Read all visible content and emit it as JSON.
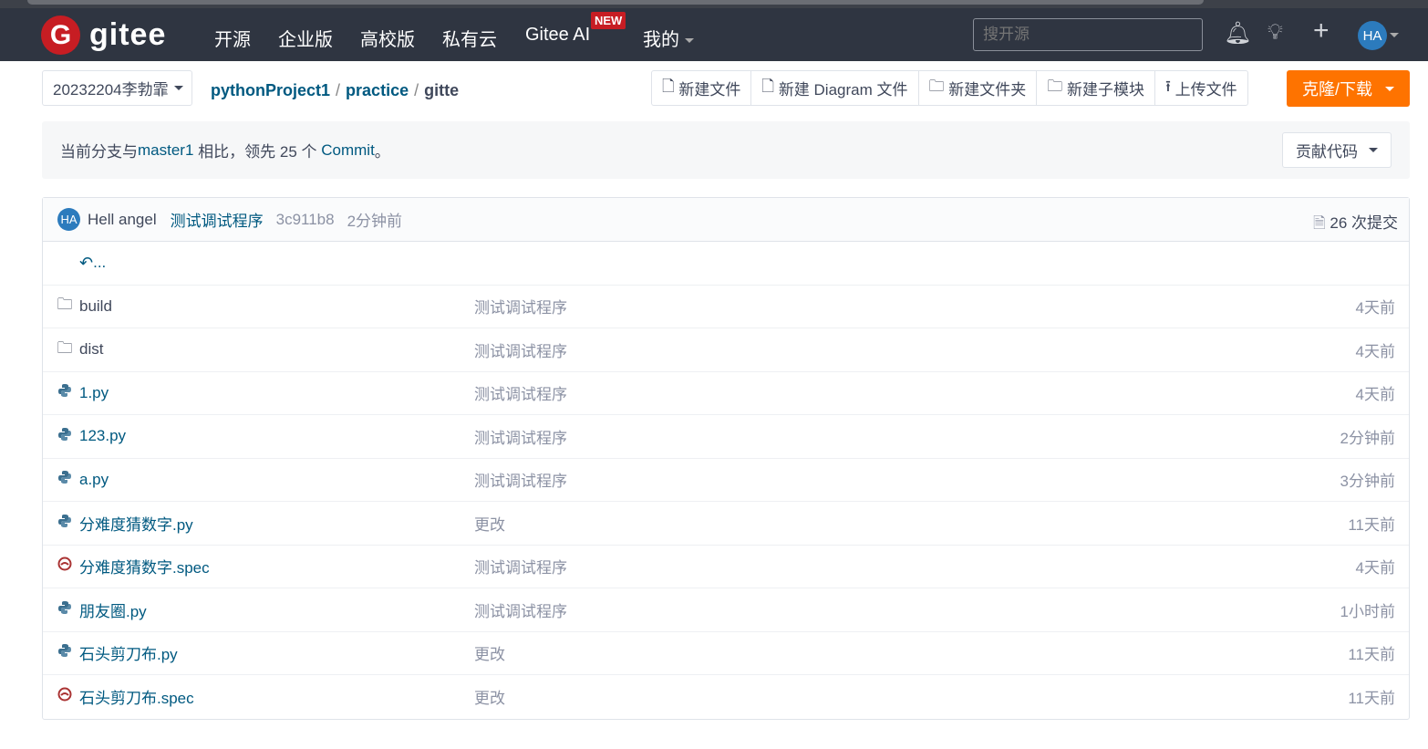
{
  "nav": {
    "logo_text": "gitee",
    "items": [
      "开源",
      "企业版",
      "高校版",
      "私有云",
      "Gitee AI",
      "我的"
    ],
    "new_badge": "NEW",
    "search_placeholder": "搜开源",
    "avatar": "HA"
  },
  "repo": {
    "branch": "20232204李勃霏",
    "breadcrumb": [
      "pythonProject1",
      "practice",
      "gitte"
    ],
    "buttons": [
      "新建文件",
      "新建 Diagram 文件",
      "新建文件夹",
      "新建子模块",
      "上传文件"
    ],
    "clone": "克隆/下载"
  },
  "notice": {
    "prefix": "当前分支与 ",
    "branch": "master1",
    "middle": " 相比，领先 25 个 ",
    "commit": "Commit",
    "suffix": "。",
    "contribute": "贡献代码"
  },
  "latest": {
    "avatar": "HA",
    "author": "Hell angel",
    "message": "测试调试程序",
    "sha": "3c911b8",
    "time": "2分钟前",
    "commits": "26 次提交"
  },
  "back": "...",
  "files": [
    {
      "name": "build",
      "type": "dir",
      "message": "测试调试程序",
      "time": "4天前"
    },
    {
      "name": "dist",
      "type": "dir",
      "message": "测试调试程序",
      "time": "4天前"
    },
    {
      "name": "1.py",
      "type": "py",
      "message": "测试调试程序",
      "time": "4天前"
    },
    {
      "name": "123.py",
      "type": "py",
      "message": "测试调试程序",
      "time": "2分钟前"
    },
    {
      "name": "a.py",
      "type": "py",
      "message": "测试调试程序",
      "time": "3分钟前"
    },
    {
      "name": "分难度猜数字.py",
      "type": "py",
      "message": "更改",
      "time": "11天前"
    },
    {
      "name": "分难度猜数字.spec",
      "type": "spec",
      "message": "测试调试程序",
      "time": "4天前"
    },
    {
      "name": "朋友圈.py",
      "type": "py",
      "message": "测试调试程序",
      "time": "1小时前"
    },
    {
      "name": "石头剪刀布.py",
      "type": "py",
      "message": "更改",
      "time": "11天前"
    },
    {
      "name": "石头剪刀布.spec",
      "type": "spec",
      "message": "更改",
      "time": "11天前"
    }
  ]
}
